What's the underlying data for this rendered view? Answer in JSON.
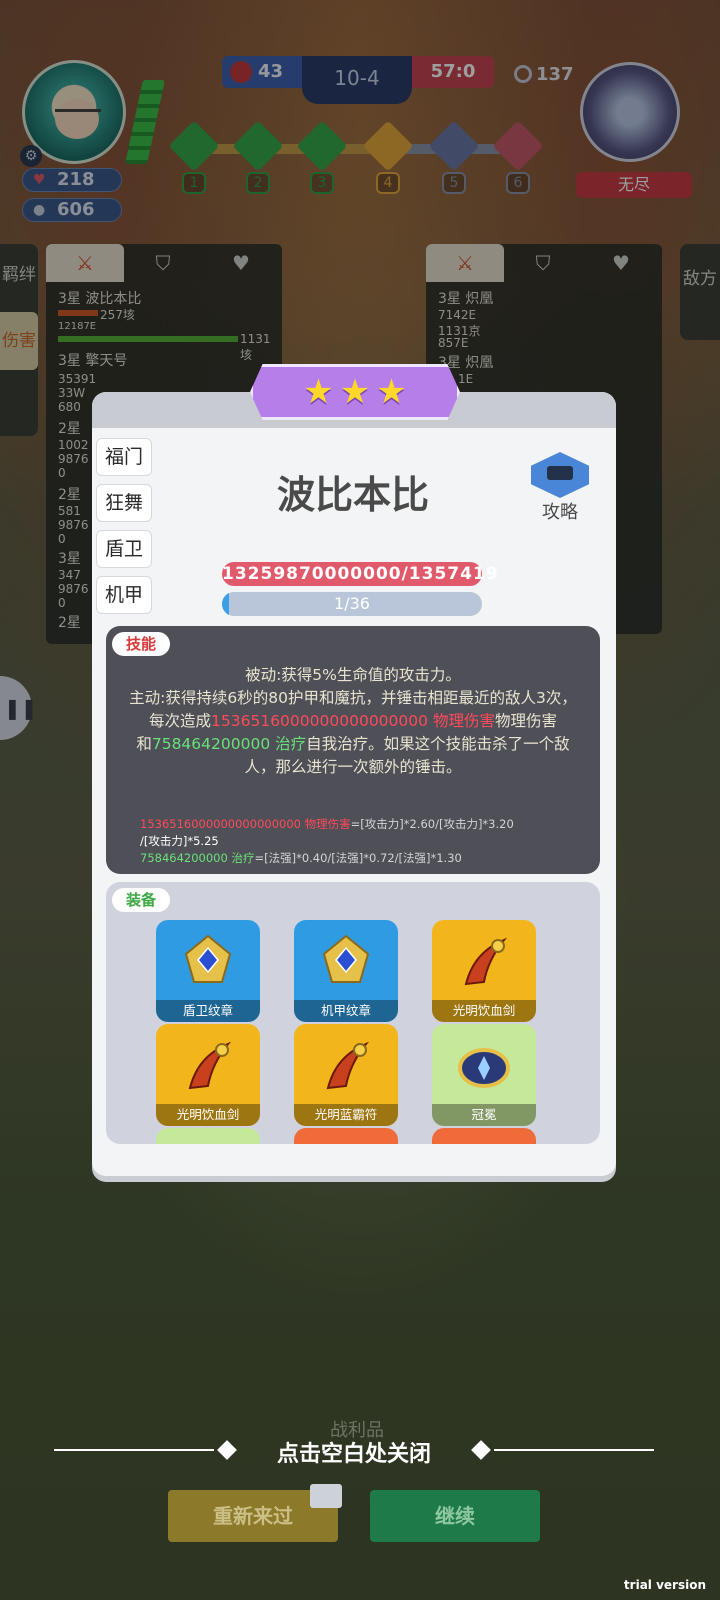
{
  "hud": {
    "player_hp": "218",
    "player_coins": "606",
    "blue_score": "43",
    "stage": "10-4",
    "red_score": "57:0",
    "timer": "137",
    "enemy_name": "无尽",
    "stage_steps": [
      "1",
      "2",
      "3",
      "4",
      "5",
      "6"
    ]
  },
  "side": {
    "left_tabs": [
      "羁绊",
      "伤害"
    ],
    "right_tab": "敌方"
  },
  "left_panel": {
    "rows": [
      {
        "name": "3星 波比本比",
        "v1": "257垓",
        "v2": "12187E",
        "v3": "1131垓"
      },
      {
        "name": "3星 擎天号",
        "v1": "35391",
        "v2": "33W",
        "v3": "680"
      },
      {
        "name": "2星",
        "v1": "1002",
        "v2": "9876",
        "v3": "0"
      },
      {
        "name": "2星",
        "v1": "581",
        "v2": "9876",
        "v3": "0"
      },
      {
        "name": "3星",
        "v1": "347",
        "v2": "9876",
        "v3": "0"
      },
      {
        "name": "2星",
        "v1": "",
        "v2": "",
        "v3": ""
      }
    ]
  },
  "right_panel": {
    "rows": [
      {
        "name": "3星 炽凰",
        "v1": "7142E",
        "v2": "1131京",
        "v3": "857E"
      },
      {
        "name": "3星 炽凰",
        "v1": "1E",
        "v2": "",
        "v3": ""
      }
    ]
  },
  "modal": {
    "stars": 3,
    "hero_name": "波比本比",
    "guide_label": "攻略",
    "side_tabs": [
      "福门",
      "狂舞",
      "盾卫",
      "机甲"
    ],
    "hp_text": "13259870000000/1357419",
    "exp_text": "1/36",
    "exp_fraction": 0.028,
    "skill_label": "技能",
    "skill": {
      "line1": "被动:获得5%生命值的攻击力。",
      "line2a": "主动:获得持续6秒的80护甲和魔抗，并锤击相距最近的敌人3次，每次造成",
      "dmg_value": "1536516000000000000000",
      "dmg_type": "物理伤害",
      "line2b": "物理伤害",
      "line3a": "和",
      "heal_value": "758464200000",
      "heal_type": "治疗",
      "line3b": "自我治疗。如果这个技能击杀了一个敌人，那么进行一次额外的锤击。",
      "formula1_value": "1536516000000000000000",
      "formula1_type": "物理伤害",
      "formula1_a": "=[攻击力]*2.60/[攻击力]*3.20",
      "formula1_b": "/[攻击力]*5.25",
      "formula2_value": "758464200000",
      "formula2_type": "治疗",
      "formula2_a": "=[法强]*0.40/[法强]*0.72/[法强]*1.30"
    },
    "equip_label": "装备",
    "equipment": [
      {
        "name": "盾卫纹章",
        "color": "blue"
      },
      {
        "name": "机甲纹章",
        "color": "blue"
      },
      {
        "name": "光明饮血剑",
        "color": "gold"
      },
      {
        "name": "光明饮血剑",
        "color": "gold"
      },
      {
        "name": "光明蓝霸符",
        "color": "gold"
      },
      {
        "name": "冠冕",
        "color": "lime"
      },
      {
        "name": "",
        "color": "lime"
      },
      {
        "name": "",
        "color": "orange"
      },
      {
        "name": "",
        "color": "orange"
      }
    ]
  },
  "bottom": {
    "close_hint": "点击空白处关闭",
    "loot_label": "战利品",
    "retry_label": "重新来过",
    "continue_label": "继续",
    "watermark": "trial version"
  }
}
